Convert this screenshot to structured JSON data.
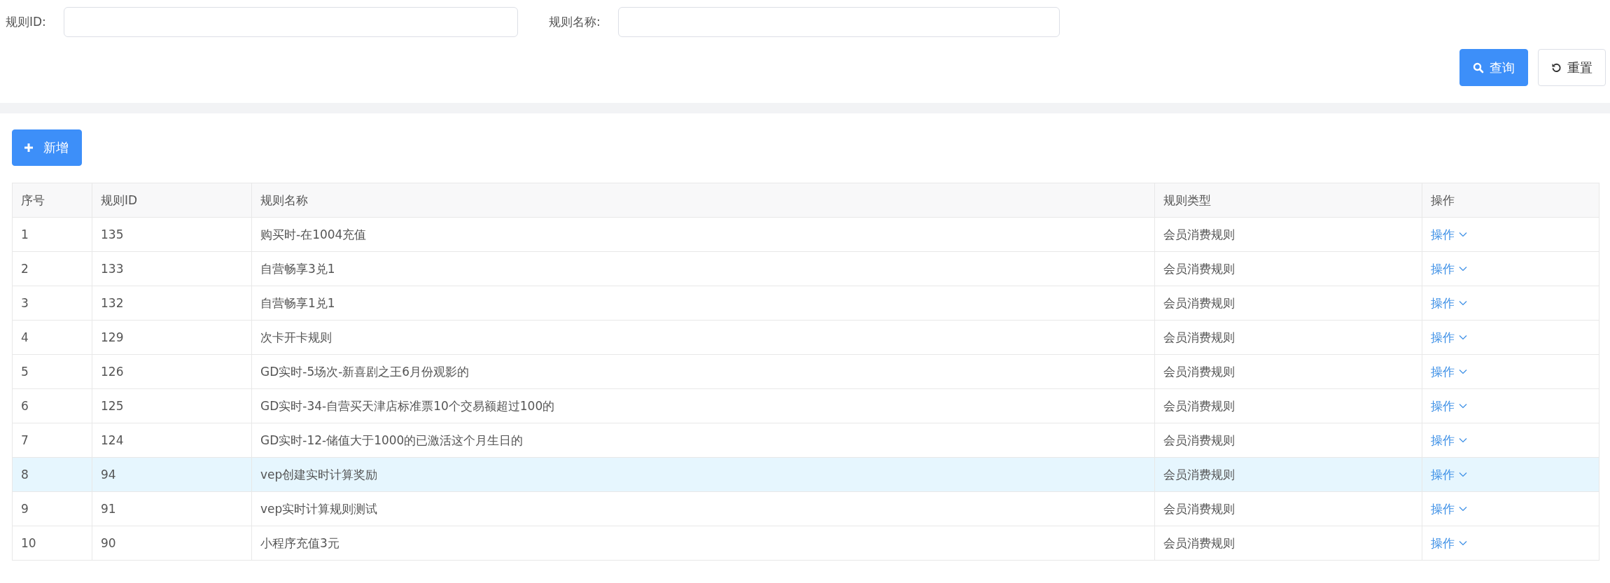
{
  "filters": [
    {
      "label": "规则ID:"
    },
    {
      "label": "规则名称:"
    }
  ],
  "buttons": [
    {
      "kind": "search",
      "label": "查询"
    },
    {
      "kind": "reset",
      "label": "重置"
    }
  ],
  "add_button": {
    "label": "新增"
  },
  "table": {
    "columns": [
      "序号",
      "规则ID",
      "规则名称",
      "规则类型",
      "操作"
    ],
    "rows": [
      {
        "index": "1",
        "id": "135",
        "name": "购买时-在1004充值",
        "type": "会员消费规则",
        "action": "操作",
        "selected": false
      },
      {
        "index": "2",
        "id": "133",
        "name": "自营畅享3兑1",
        "type": "会员消费规则",
        "action": "操作",
        "selected": false
      },
      {
        "index": "3",
        "id": "132",
        "name": "自营畅享1兑1",
        "type": "会员消费规则",
        "action": "操作",
        "selected": false
      },
      {
        "index": "4",
        "id": "129",
        "name": "次卡开卡规则",
        "type": "会员消费规则",
        "action": "操作",
        "selected": false
      },
      {
        "index": "5",
        "id": "126",
        "name": "GD实时-5场次-新喜剧之王6月份观影的",
        "type": "会员消费规则",
        "action": "操作",
        "selected": false
      },
      {
        "index": "6",
        "id": "125",
        "name": "GD实时-34-自营买天津店标准票10个交易额超过100的",
        "type": "会员消费规则",
        "action": "操作",
        "selected": false
      },
      {
        "index": "7",
        "id": "124",
        "name": "GD实时-12-储值大于1000的已激活这个月生日的",
        "type": "会员消费规则",
        "action": "操作",
        "selected": false
      },
      {
        "index": "8",
        "id": "94",
        "name": "vep创建实时计算奖励",
        "type": "会员消费规则",
        "action": "操作",
        "selected": true
      },
      {
        "index": "9",
        "id": "91",
        "name": "vep实时计算规则测试",
        "type": "会员消费规则",
        "action": "操作",
        "selected": false
      },
      {
        "index": "10",
        "id": "90",
        "name": "小程序充值3元",
        "type": "会员消费规则",
        "action": "操作",
        "selected": false
      }
    ]
  }
}
